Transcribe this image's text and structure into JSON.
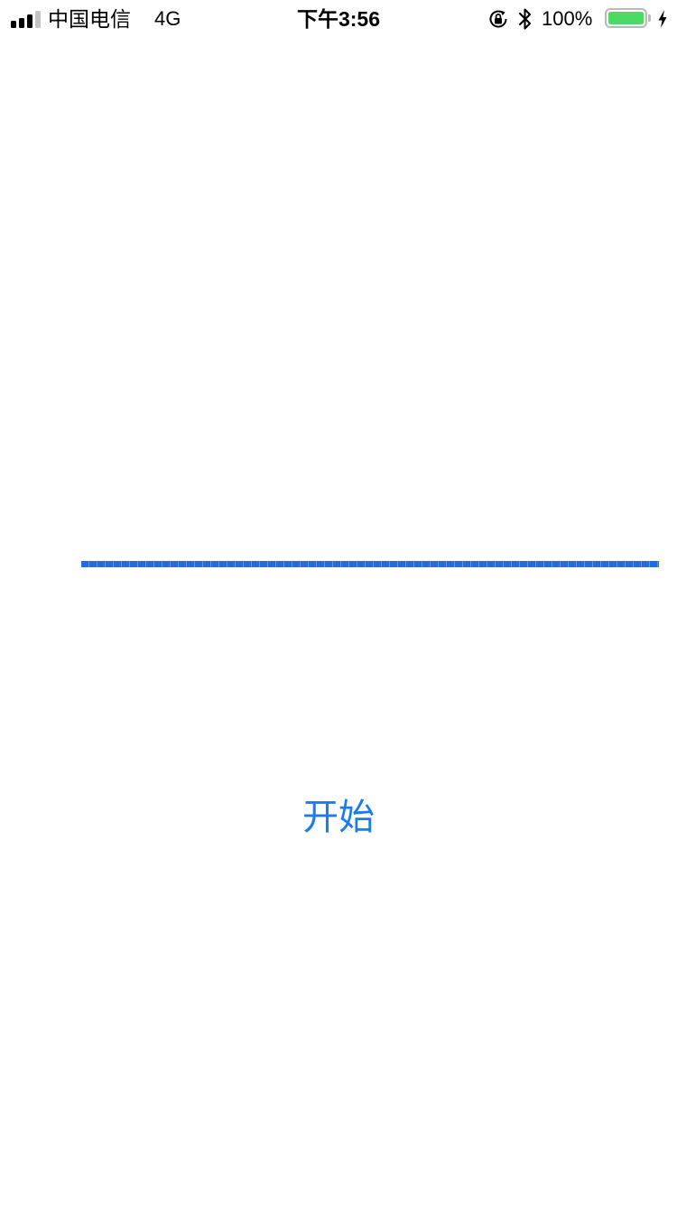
{
  "status_bar": {
    "carrier": "中国电信",
    "network": "4G",
    "time": "下午3:56",
    "battery_percent_label": "100%",
    "battery_level": 1.0,
    "battery_color": "#4cd964",
    "signal_bars_active": 3,
    "signal_bars_total": 4,
    "icons": [
      "orientation-lock-icon",
      "bluetooth-icon",
      "battery-icon",
      "charging-bolt-icon"
    ]
  },
  "progress": {
    "value": 1.0,
    "color": "#1d6fe0"
  },
  "start_button": {
    "label": "开始",
    "color": "#1b7bf2"
  }
}
